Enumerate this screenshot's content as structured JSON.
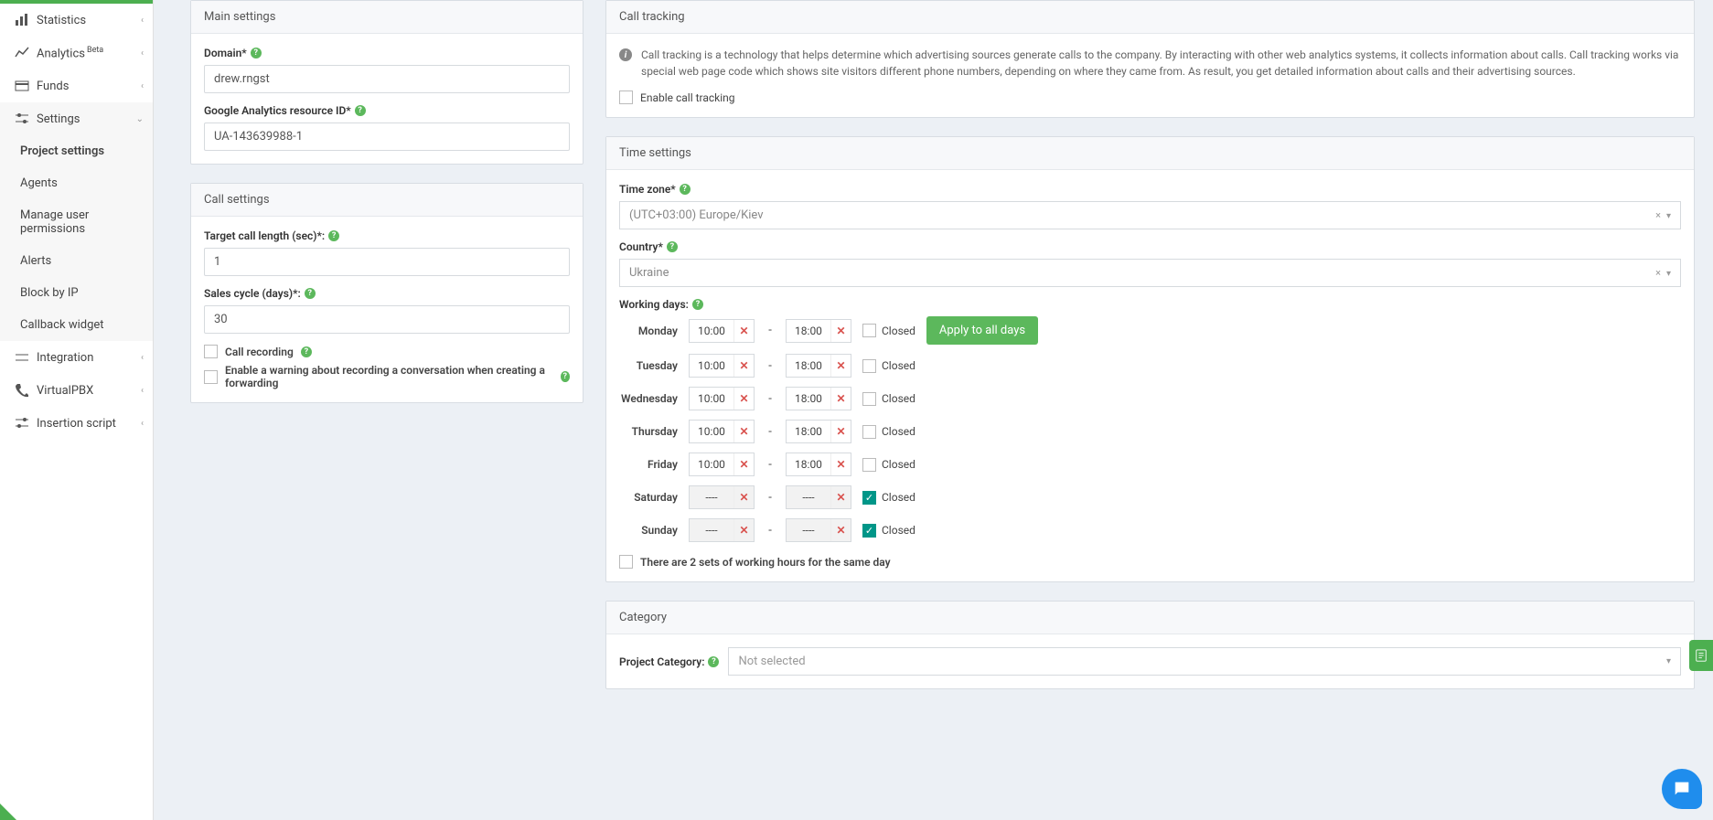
{
  "sidebar": {
    "statistics": "Statistics",
    "analytics": "Analytics",
    "analytics_badge": "Beta",
    "funds": "Funds",
    "settings": "Settings",
    "sub": {
      "project_settings": "Project settings",
      "agents": "Agents",
      "permissions": "Manage user permissions",
      "alerts": "Alerts",
      "block_ip": "Block by IP",
      "callback": "Callback widget"
    },
    "integration": "Integration",
    "virtualpbx": "VirtualPBX",
    "insertion": "Insertion script"
  },
  "main_settings": {
    "title": "Main settings",
    "domain_label": "Domain*",
    "domain_value": "drew.rngst",
    "ga_label": "Google Analytics resource ID*",
    "ga_value": "UA-143639988-1"
  },
  "call_settings": {
    "title": "Call settings",
    "target_label": "Target call length (sec)*:",
    "target_value": "1",
    "cycle_label": "Sales cycle (days)*:",
    "cycle_value": "30",
    "recording_label": "Call recording",
    "warning_label": "Enable a warning about recording a conversation when creating a forwarding"
  },
  "call_tracking": {
    "title": "Call tracking",
    "info": "Call tracking is a technology that helps determine which advertising sources generate calls to the company. By interacting with other web analytics systems, it collects information about calls. Call tracking works via special web page code which shows site visitors different phone numbers, depending on where they came from. As result, you get detailed information about calls and their advertising sources.",
    "enable_label": "Enable call tracking"
  },
  "time_settings": {
    "title": "Time settings",
    "tz_label": "Time zone*",
    "tz_value": "(UTC+03:00) Europe/Kiev",
    "country_label": "Country*",
    "country_value": "Ukraine",
    "working_label": "Working days:",
    "apply_label": "Apply to all days",
    "closed_label": "Closed",
    "two_sets_label": "There are 2 sets of working hours for the same day",
    "dash_placeholder": "----",
    "days": [
      {
        "name": "Monday",
        "from": "10:00",
        "to": "18:00",
        "closed": false
      },
      {
        "name": "Tuesday",
        "from": "10:00",
        "to": "18:00",
        "closed": false
      },
      {
        "name": "Wednesday",
        "from": "10:00",
        "to": "18:00",
        "closed": false
      },
      {
        "name": "Thursday",
        "from": "10:00",
        "to": "18:00",
        "closed": false
      },
      {
        "name": "Friday",
        "from": "10:00",
        "to": "18:00",
        "closed": false
      },
      {
        "name": "Saturday",
        "from": "----",
        "to": "----",
        "closed": true
      },
      {
        "name": "Sunday",
        "from": "----",
        "to": "----",
        "closed": true
      }
    ]
  },
  "category": {
    "title": "Category",
    "label": "Project Category:",
    "value": "Not selected"
  }
}
